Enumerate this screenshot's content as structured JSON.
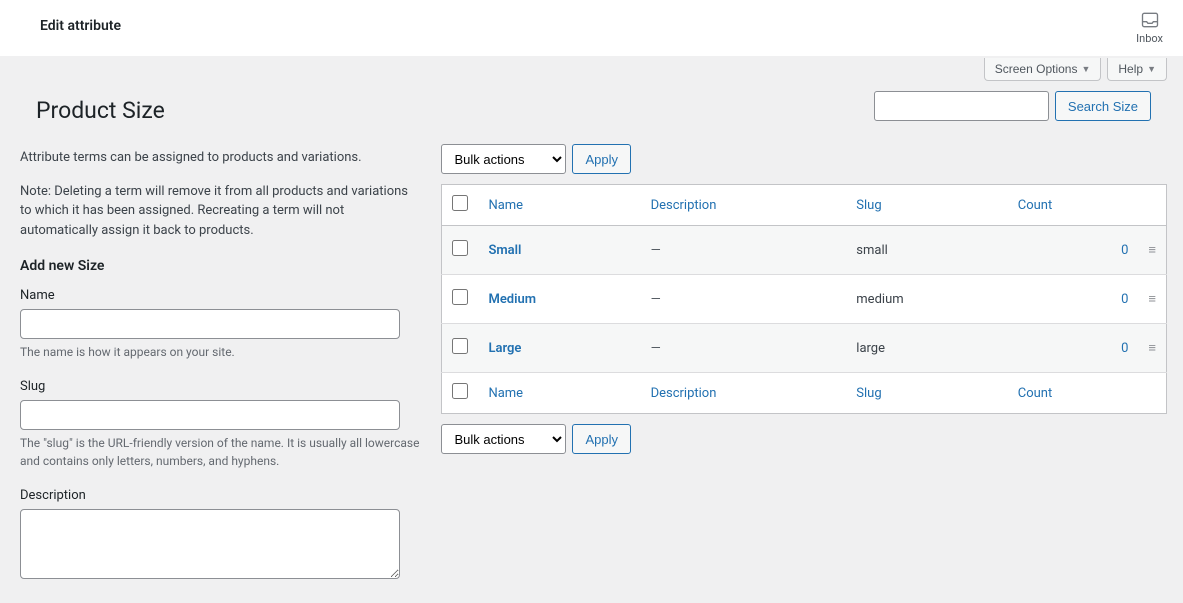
{
  "topbar": {
    "edit_attribute": "Edit attribute",
    "inbox": "Inbox"
  },
  "tabs": {
    "screen_options": "Screen Options",
    "help": "Help"
  },
  "page": {
    "title": "Product Size",
    "search_button": "Search Size"
  },
  "left": {
    "intro": "Attribute terms can be assigned to products and variations.",
    "note": "Note: Deleting a term will remove it from all products and variations to which it has been assigned. Recreating a term will not automatically assign it back to products.",
    "add_title": "Add new Size",
    "name_label": "Name",
    "name_help": "The name is how it appears on your site.",
    "slug_label": "Slug",
    "slug_help": "The \"slug\" is the URL-friendly version of the name. It is usually all lowercase and contains only letters, numbers, and hyphens.",
    "desc_label": "Description"
  },
  "bulk": {
    "label": "Bulk actions",
    "apply": "Apply"
  },
  "table": {
    "headers": {
      "name": "Name",
      "description": "Description",
      "slug": "Slug",
      "count": "Count"
    },
    "rows": [
      {
        "name": "Small",
        "desc": "—",
        "slug": "small",
        "count": "0"
      },
      {
        "name": "Medium",
        "desc": "—",
        "slug": "medium",
        "count": "0"
      },
      {
        "name": "Large",
        "desc": "—",
        "slug": "large",
        "count": "0"
      }
    ]
  }
}
